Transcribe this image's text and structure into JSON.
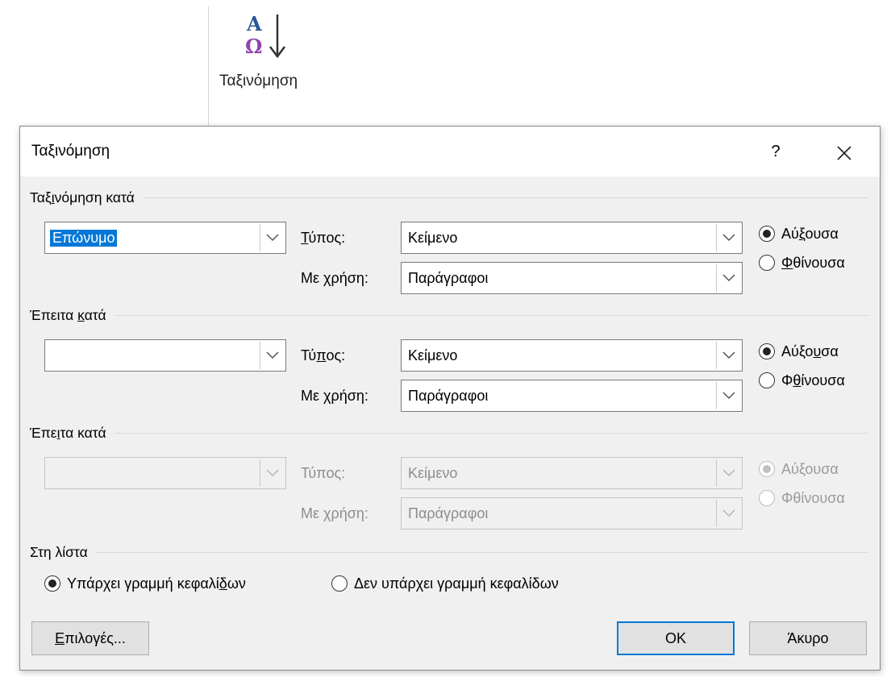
{
  "ribbon": {
    "sort_label": "Ταξινόμηση",
    "sort_icon": "sort-az-icon",
    "icon_letter_top": "A",
    "icon_letter_bottom": "Ω"
  },
  "dialog": {
    "title": "Ταξινόμηση",
    "help": "?",
    "close": "✕",
    "sort_by": {
      "label": "Ταξινόμηση κατά",
      "field_value": "Επώνυμο",
      "type_label": "Τύπος:",
      "type_value": "Κείμενο",
      "using_label": "Με χρήση:",
      "using_value": "Παράγραφοι",
      "ascending": "Αύξουσα",
      "descending": "Φθίνουσα",
      "selected_order": "ascending",
      "enabled": true
    },
    "then_by_1": {
      "label": "Έπειτα κατά",
      "field_value": "",
      "type_label": "Τύπος:",
      "type_value": "Κείμενο",
      "using_label": "Με χρήση:",
      "using_value": "Παράγραφοι",
      "ascending": "Αύξουσα",
      "descending": "Φθίνουσα",
      "selected_order": "ascending",
      "enabled": true
    },
    "then_by_2": {
      "label": "Έπειτα κατά",
      "field_value": "",
      "type_label": "Τύπος:",
      "type_value": "Κείμενο",
      "using_label": "Με χρήση:",
      "using_value": "Παράγραφοι",
      "ascending": "Αύξουσα",
      "descending": "Φθίνουσα",
      "selected_order": "ascending",
      "enabled": false
    },
    "my_list": {
      "label": "Στη λίστα",
      "header_row": "Υπάρχει γραμμή κεφαλίδων",
      "no_header_row": "Δεν υπάρχει γραμμή κεφαλίδων",
      "selected": "header_row"
    },
    "buttons": {
      "options": "Επιλογές...",
      "ok": "OK",
      "cancel": "Άκυρο"
    }
  }
}
